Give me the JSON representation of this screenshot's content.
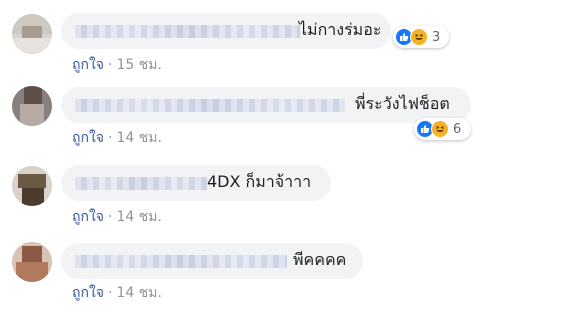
{
  "comments": [
    {
      "text": "ไม่กางร่มอะ",
      "reaction_count": "3",
      "action_like": "ถูกใจ",
      "separator": "·",
      "time": "15 ชม.",
      "reaction_icons": [
        "like-icon",
        "haha-icon"
      ]
    },
    {
      "text": "พี่ระวังไฟช็อต",
      "reaction_count": "6",
      "action_like": "ถูกใจ",
      "separator": "·",
      "time": "14 ชม.",
      "reaction_icons": [
        "like-icon",
        "haha-icon"
      ]
    },
    {
      "text": "4DX ก็มาจ้าาา",
      "action_like": "ถูกใจ",
      "separator": "·",
      "time": "14 ชม."
    },
    {
      "text": "พีคคคค",
      "action_like": "ถูกใจ",
      "separator": "·",
      "time": "14 ชม."
    }
  ],
  "colors": {
    "bubble": "#f2f3f5",
    "like_blue": "#1877f2",
    "haha_yellow": "#f7b125",
    "link": "#385898",
    "meta": "#90949c"
  }
}
